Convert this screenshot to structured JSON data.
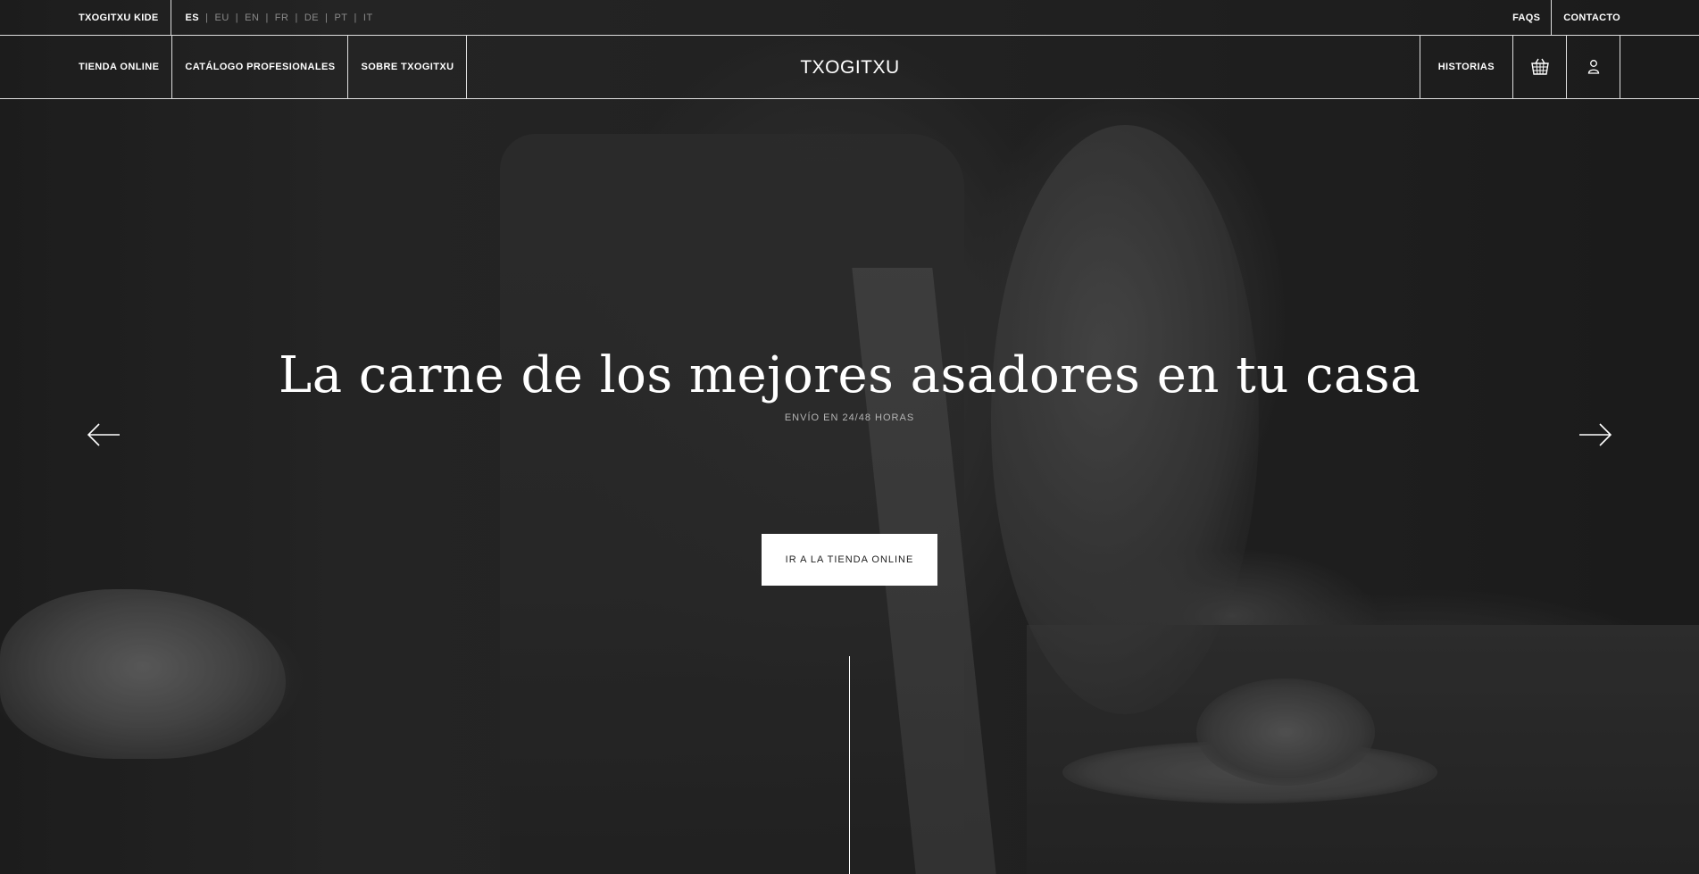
{
  "topbar": {
    "kide_label": "TXOGITXU KIDE",
    "languages": [
      {
        "code": "ES",
        "active": true
      },
      {
        "code": "EU",
        "active": false
      },
      {
        "code": "EN",
        "active": false
      },
      {
        "code": "FR",
        "active": false
      },
      {
        "code": "DE",
        "active": false
      },
      {
        "code": "PT",
        "active": false
      },
      {
        "code": "IT",
        "active": false
      }
    ],
    "faqs_label": "FAQS",
    "contact_label": "CONTACTO"
  },
  "nav": {
    "left_items": [
      {
        "label": "TIENDA ONLINE"
      },
      {
        "label": "CATÁLOGO PROFESIONALES"
      },
      {
        "label": "SOBRE TXOGITXU"
      }
    ],
    "logo_text": "TXOGITXU",
    "historias_label": "HISTORIAS",
    "cart_icon": "basket-icon",
    "user_icon": "user-icon"
  },
  "hero": {
    "headline": "La carne de los mejores asadores en tu casa",
    "subline": "ENVÍO EN 24/48 HORAS",
    "cta_label": "IR A LA TIENDA ONLINE",
    "prev_icon": "arrow-left-icon",
    "next_icon": "arrow-right-icon"
  },
  "colors": {
    "background": "#1c1c1c",
    "text": "#ffffff",
    "muted": "#8a8a8a",
    "cta_bg": "#ffffff",
    "cta_text": "#222222"
  }
}
